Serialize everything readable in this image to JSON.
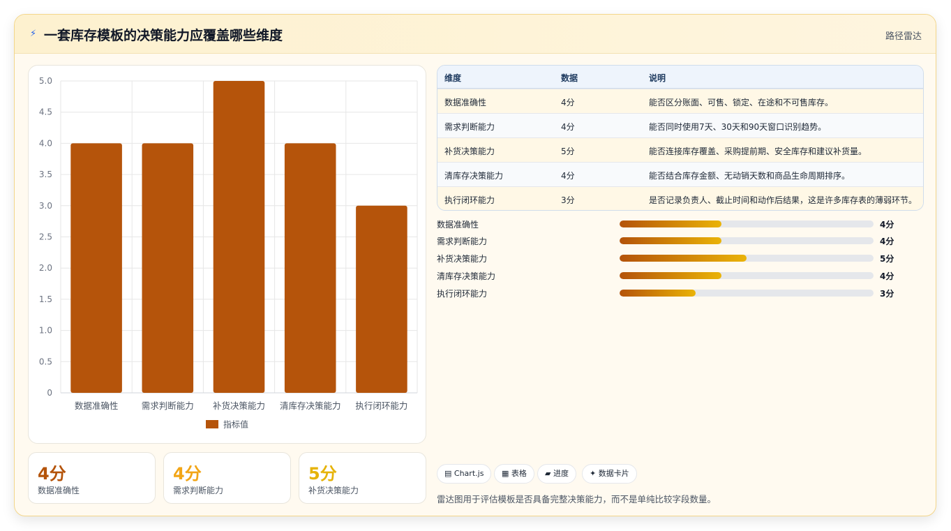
{
  "header": {
    "title": "一套库存模板的决策能力应覆盖哪些维度",
    "route_label": "路径雷达"
  },
  "colors": {
    "bar": "#b5540b",
    "stat_1": "#b45309",
    "stat_2": "#f2a516",
    "stat_3": "#e6b30a"
  },
  "chart_data": {
    "type": "bar",
    "categories": [
      "数据准确性",
      "需求判断能力",
      "补货决策能力",
      "清库存决策能力",
      "执行闭环能力"
    ],
    "series": [
      {
        "name": "指标值",
        "values": [
          4,
          4,
          5,
          4,
          3
        ]
      }
    ],
    "ylim": [
      0,
      5
    ],
    "yticks": [
      "0",
      "0.5",
      "1.0",
      "1.5",
      "2.0",
      "2.5",
      "3.0",
      "3.5",
      "4.0",
      "4.5",
      "5.0"
    ],
    "grid": true,
    "legend_position": "bottom"
  },
  "stats": [
    {
      "value": "4分",
      "label": "数据准确性"
    },
    {
      "value": "4分",
      "label": "需求判断能力"
    },
    {
      "value": "5分",
      "label": "补货决策能力"
    }
  ],
  "table": {
    "headers": [
      "维度",
      "数据",
      "说明"
    ],
    "rows": [
      [
        "数据准确性",
        "4分",
        "能否区分账面、可售、锁定、在途和不可售库存。"
      ],
      [
        "需求判断能力",
        "4分",
        "能否同时使用7天、30天和90天窗口识别趋势。"
      ],
      [
        "补货决策能力",
        "5分",
        "能否连接库存覆盖、采购提前期、安全库存和建议补货量。"
      ],
      [
        "清库存决策能力",
        "4分",
        "能否结合库存金额、无动销天数和商品生命周期排序。"
      ],
      [
        "执行闭环能力",
        "3分",
        "是否记录负责人、截止时间和动作后结果，这是许多库存表的薄弱环节。"
      ]
    ]
  },
  "progress": [
    {
      "label": "数据准确性",
      "value": 4,
      "max": 10,
      "text": "4分"
    },
    {
      "label": "需求判断能力",
      "value": 4,
      "max": 10,
      "text": "4分"
    },
    {
      "label": "补货决策能力",
      "value": 5,
      "max": 10,
      "text": "5分"
    },
    {
      "label": "清库存决策能力",
      "value": 4,
      "max": 10,
      "text": "4分"
    },
    {
      "label": "执行闭环能力",
      "value": 3,
      "max": 10,
      "text": "3分"
    }
  ],
  "tags": [
    {
      "icon": "chart-icon",
      "glyph": "▤",
      "label": "Chart.js"
    },
    {
      "icon": "table-icon",
      "glyph": "▦",
      "label": "表格"
    },
    {
      "icon": "progress-icon",
      "glyph": "▰",
      "label": "进度"
    },
    {
      "icon": "sparkle-icon",
      "glyph": "✦",
      "label": "数据卡片"
    }
  ],
  "footnote": "雷达图用于评估模板是否具备完整决策能力，而不是单纯比较字段数量。"
}
